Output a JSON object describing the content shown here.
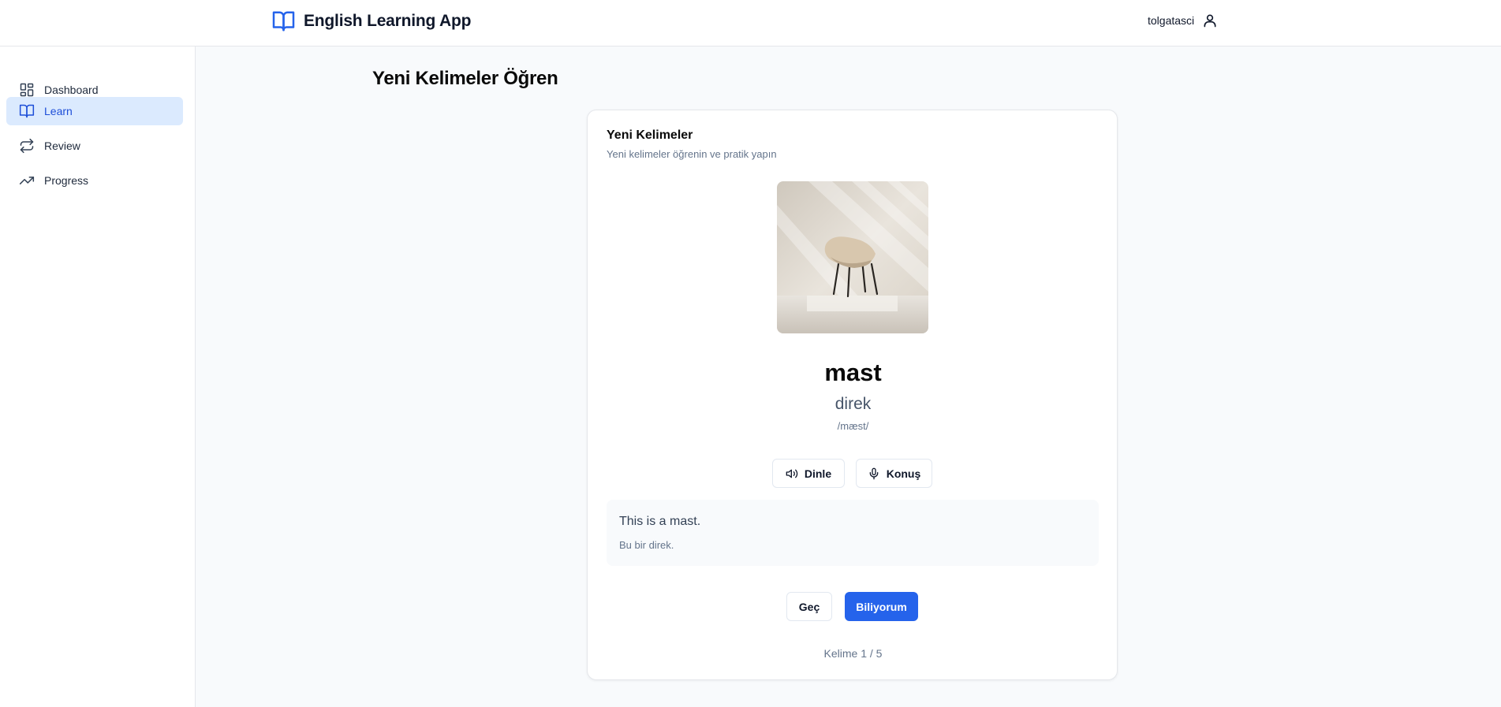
{
  "header": {
    "app_title": "English Learning App",
    "brand_icon": "book-open-icon",
    "username": "tolgatasci",
    "user_icon": "user-icon",
    "brand_color": "#2563eb"
  },
  "sidebar": {
    "items": [
      {
        "label": "Dashboard",
        "icon": "layout-grid-icon",
        "active": false
      },
      {
        "label": "Learn",
        "icon": "book-open-icon",
        "active": true
      },
      {
        "label": "Review",
        "icon": "repeat-icon",
        "active": false
      },
      {
        "label": "Progress",
        "icon": "trending-up-icon",
        "active": false
      }
    ]
  },
  "main": {
    "page_title": "Yeni Kelimeler Öğren",
    "card": {
      "title": "Yeni Kelimeler",
      "description": "Yeni kelimeler öğrenin ve pratik yapın",
      "word": "mast",
      "translation": "direk",
      "phonetic": "/mæst/",
      "listen_label": "Dinle",
      "listen_icon": "volume-icon",
      "speak_label": "Konuş",
      "speak_icon": "microphone-icon",
      "example_en": "This is a mast.",
      "example_tr": "Bu bir direk.",
      "skip_label": "Geç",
      "know_label": "Biliyorum",
      "counter": "Kelime 1 / 5",
      "progress": {
        "current": 1,
        "total": 5
      }
    }
  },
  "colors": {
    "accent": "#2563eb",
    "active_nav_bg": "#dbeafe",
    "page_bg": "#f8fafc"
  }
}
